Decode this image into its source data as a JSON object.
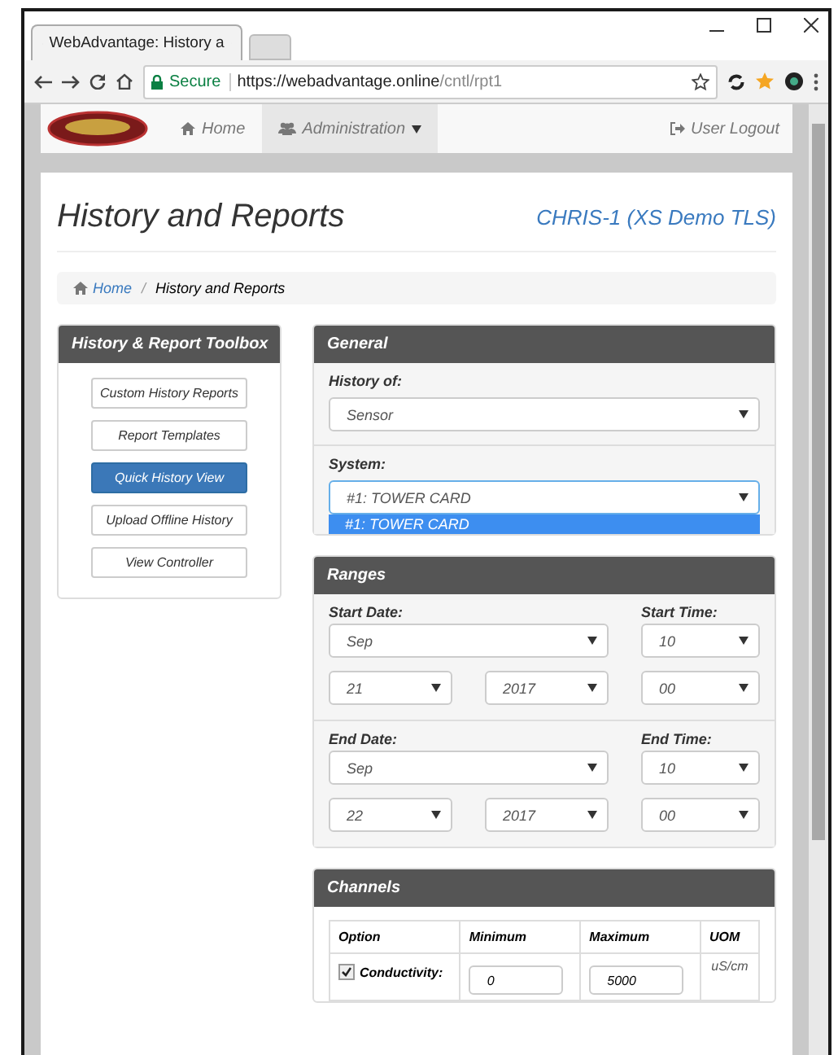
{
  "browser": {
    "tab_title": "WebAdvantage: History a",
    "secure_label": "Secure",
    "url_host": "https://webadvantage.online",
    "url_path": "/cntl/rpt1"
  },
  "navbar": {
    "items": [
      {
        "label": "Home",
        "selected": false
      },
      {
        "label": "Administration",
        "selected": true
      }
    ],
    "logout": "User Logout"
  },
  "header": {
    "title": "History and Reports",
    "device": "CHRIS-1 (XS Demo TLS)"
  },
  "breadcrumb": [
    {
      "label": "Home",
      "kind": "link"
    },
    {
      "label": "/",
      "kind": "separator"
    },
    {
      "label": "History and Reports",
      "kind": "current"
    }
  ],
  "toolbox": {
    "title": "History & Report Toolbox",
    "buttons": [
      {
        "label": "Custom History Reports",
        "selected": false
      },
      {
        "label": "Report Templates",
        "selected": false
      },
      {
        "label": "Quick History View",
        "selected": true
      },
      {
        "label": "Upload Offline History",
        "selected": false
      },
      {
        "label": "View Controller",
        "selected": false
      }
    ]
  },
  "general": {
    "title": "General",
    "history_of": {
      "label": "History of:",
      "value": "Sensor"
    },
    "system": {
      "label": "System:",
      "value": "#1: TOWER CARD",
      "options": [
        {
          "label": "#1: TOWER CARD",
          "selected": true
        }
      ]
    }
  },
  "ranges": {
    "title": "Ranges",
    "groups": [
      {
        "date_label": "Start Date:",
        "time_label": "Start Time:",
        "month": "Sep",
        "hour": "10",
        "day": "21",
        "year": "2017",
        "minute": "00"
      },
      {
        "date_label": "End Date:",
        "time_label": "End Time:",
        "month": "Sep",
        "hour": "10",
        "day": "22",
        "year": "2017",
        "minute": "00"
      }
    ]
  },
  "channels": {
    "title": "Channels",
    "columns": [
      "Option",
      "Minimum",
      "Maximum",
      "UOM"
    ],
    "rows": [
      {
        "option": "Conductivity:",
        "checked": true,
        "minimum": "0",
        "maximum": "5000",
        "uom": "uS/cm"
      }
    ]
  }
}
